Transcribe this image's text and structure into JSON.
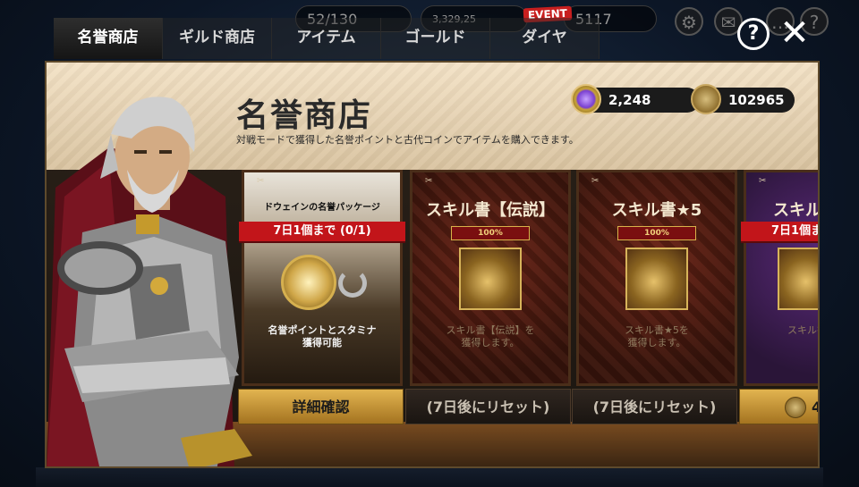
{
  "tabs": [
    {
      "label": "名誉商店",
      "active": true
    },
    {
      "label": "ギルド商店",
      "active": false
    },
    {
      "label": "アイテム",
      "active": false
    },
    {
      "label": "ゴールド",
      "active": false
    },
    {
      "label": "ダイヤ",
      "active": false
    }
  ],
  "event_badge": "EVENT",
  "background_hud": {
    "stamina": "52/130",
    "gold": "3,329,25",
    "diamonds": "5117"
  },
  "header": {
    "title": "名誉商店",
    "description": "対戦モードで獲得した名誉ポイントと古代コインでアイテムを購入できます。",
    "help_icon": "?",
    "close_icon": "✕"
  },
  "currencies": {
    "honor_points": "2,248",
    "ancient_coins": "102965"
  },
  "cards": [
    {
      "title": "ドウェインの名誉パッケージ",
      "limit": "7日1個まで (0/1)",
      "description": "名誉ポイントとスタミナ\n獲得可能",
      "button": "詳細確認"
    },
    {
      "title": "スキル書【伝説】",
      "badge": "100%",
      "description": "スキル書【伝説】を\n獲得します。",
      "button": "(7日後にリセット)"
    },
    {
      "title": "スキル書★5",
      "badge": "100%",
      "description": "スキル書★5を\n獲得します。",
      "button": "(7日後にリセット)"
    },
    {
      "title": "スキル",
      "limit": "7日1個ま",
      "description": "スキル書",
      "button": "4"
    }
  ],
  "colors": {
    "accent_gold": "#e2b450",
    "limit_red": "#c2151a",
    "panel_header": "#f3e2c6"
  }
}
